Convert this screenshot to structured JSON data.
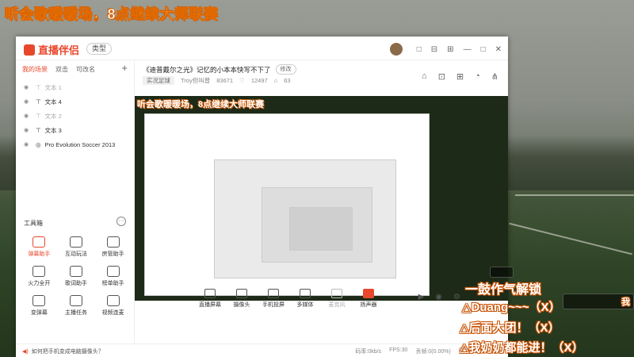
{
  "overlay_title": "听会歌暖暖场，8点继续大师联赛",
  "app": {
    "logo": "直播伴侣",
    "type_button": "类型",
    "window_icons": [
      "□",
      "⊟",
      "⊞",
      "—",
      "□",
      "✕"
    ]
  },
  "sidebar": {
    "tabs": [
      "我的场景",
      "双击",
      "可改名"
    ],
    "add": "+",
    "sources": [
      {
        "label": "文本 1",
        "dim": true
      },
      {
        "label": "文本 4",
        "dim": false
      },
      {
        "label": "文本 2",
        "dim": true
      },
      {
        "label": "文本 3",
        "dim": false
      },
      {
        "label": "Pro Evolution Soccer 2013",
        "dim": false
      }
    ],
    "tools_title": "工具箱",
    "tools": [
      {
        "label": "弹幕助手",
        "hot": true
      },
      {
        "label": "互动玩法",
        "hot": false
      },
      {
        "label": "房管助手",
        "hot": false
      },
      {
        "label": "火力全开",
        "hot": false
      },
      {
        "label": "歌词助手",
        "hot": false
      },
      {
        "label": "榜单助手",
        "hot": false
      },
      {
        "label": "变弹幕",
        "hot": false
      },
      {
        "label": "主播任务",
        "hot": false
      },
      {
        "label": "视频连麦",
        "hot": false
      }
    ]
  },
  "main": {
    "stream_title": "《迪普戴尔之光》记忆的小本本快写不下了",
    "edit_label": "修改",
    "category": "实况足球",
    "streamer": "Troy但叫普",
    "id": "83671",
    "followers": "12497",
    "viewers": "63",
    "preview_title": "听会歌暖暖场，8点继续大师联赛"
  },
  "bottom_buttons": [
    {
      "label": "直播屏幕",
      "style": "normal"
    },
    {
      "label": "摄像头",
      "style": "normal"
    },
    {
      "label": "手机投屏",
      "style": "normal"
    },
    {
      "label": "多媒体",
      "style": "normal"
    },
    {
      "label": "麦克风",
      "style": "dim"
    },
    {
      "label": "扬声器",
      "style": "red"
    }
  ],
  "status": {
    "tip": "如何把手机变成电脑摄像头？",
    "bitrate": "码率:0kb/s",
    "fps": "FPS:30",
    "dropped": "丢帧:0(0.00%)",
    "cpu": "CPU:11%",
    "memory": "内存:"
  },
  "danmu": [
    "△Duang~~~（X）",
    "△后面大团！（X）",
    "△我奶奶都能进！（X）",
    "一鼓作气解锁"
  ],
  "right_badge": "我"
}
